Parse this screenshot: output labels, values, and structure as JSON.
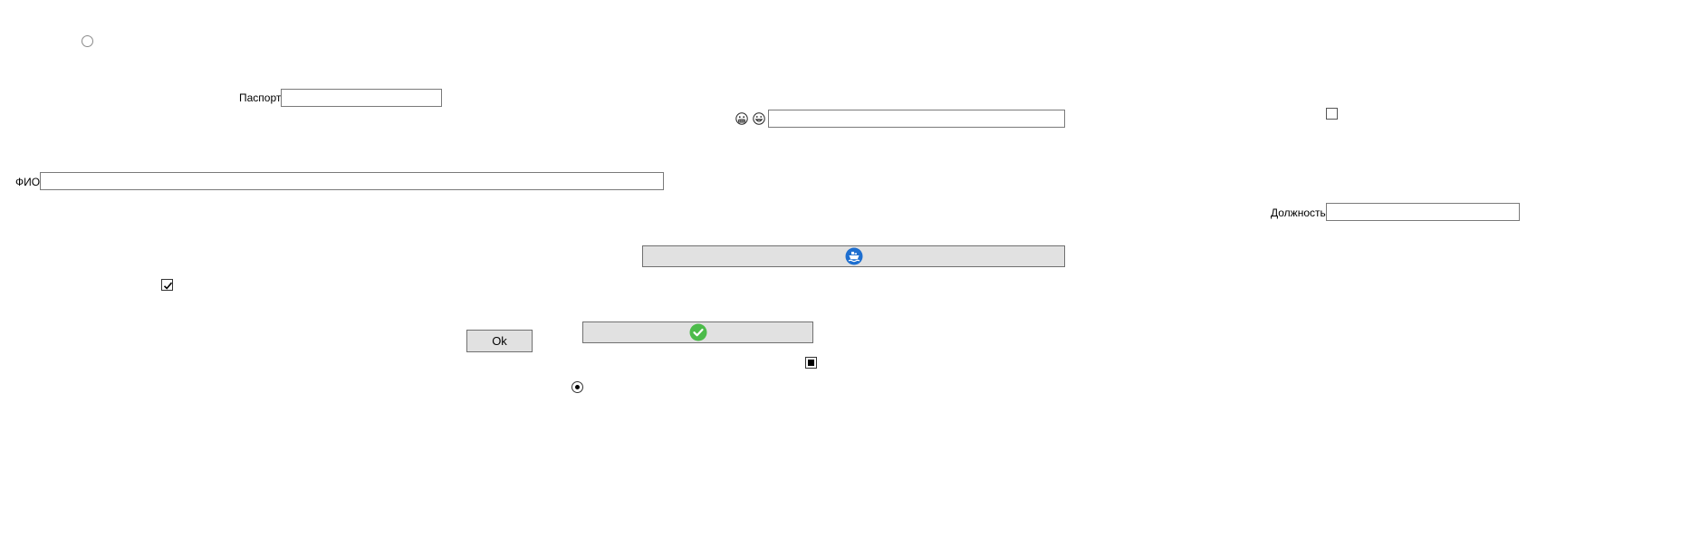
{
  "form": {
    "passport": {
      "label": "Паспорт",
      "value": "",
      "placeholder": ""
    },
    "fio": {
      "label": "ФИО",
      "value": "",
      "placeholder": ""
    },
    "position": {
      "label": "Должность",
      "value": "",
      "placeholder": ""
    },
    "emoji_field": {
      "value": "",
      "placeholder": ""
    },
    "ok_button": {
      "label": "Ok"
    },
    "ship_button": {
      "label": "",
      "icon": "ship-icon",
      "icon_color": "#1e6fd0"
    },
    "check_button": {
      "label": "",
      "icon": "check-circle-icon",
      "icon_color": "#4cbb4a"
    },
    "radio_top": {
      "checked": false
    },
    "radio_bottom": {
      "checked": true
    },
    "checkbox_right": {
      "checked": false
    },
    "checkbox_left": {
      "checked": true
    },
    "checkbox_indeterminate": {
      "state": "indeterminate"
    },
    "emoji_icons": [
      "grimacing-face-icon",
      "grinning-face-icon"
    ]
  },
  "colors": {
    "button_bg": "#e1e1e1",
    "button_border": "#707070",
    "input_border": "#7a7a7a",
    "background": "#ffffff"
  }
}
